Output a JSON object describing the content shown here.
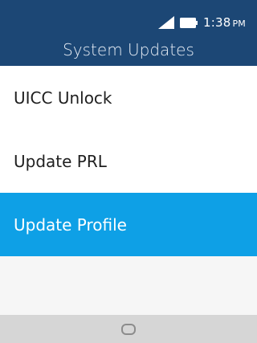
{
  "status_bar": {
    "time": "1:38",
    "ampm": "PM"
  },
  "header": {
    "title": "System Updates"
  },
  "menu": {
    "items": [
      {
        "label": "UICC Unlock",
        "selected": false
      },
      {
        "label": "Update PRL",
        "selected": false
      },
      {
        "label": "Update Profile",
        "selected": true
      }
    ]
  },
  "colors": {
    "header_bg": "#1c4775",
    "selected_bg": "#0ea0e6",
    "softkey_bar_bg": "#d6d6d6"
  },
  "icons": {
    "signal": "signal-icon",
    "battery": "battery-icon",
    "center_softkey": "circle-softkey-icon"
  }
}
